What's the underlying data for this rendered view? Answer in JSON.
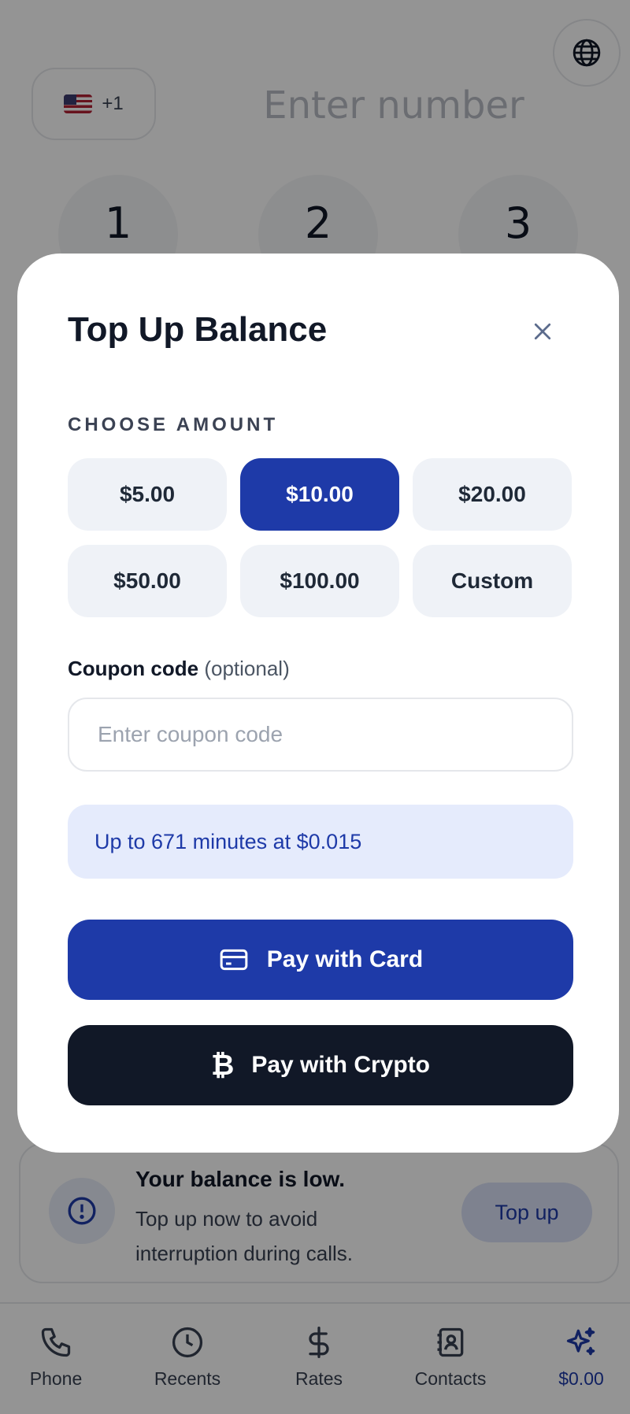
{
  "dialer": {
    "country_code": "+1",
    "number_placeholder": "Enter number",
    "keys": [
      "1",
      "2",
      "3"
    ]
  },
  "balance_alert": {
    "title": "Your balance is low.",
    "message": "Top up now to avoid interruption during calls.",
    "button_label": "Top up"
  },
  "nav": {
    "items": [
      {
        "label": "Phone",
        "icon": "phone-icon"
      },
      {
        "label": "Recents",
        "icon": "clock-icon"
      },
      {
        "label": "Rates",
        "icon": "dollar-icon"
      },
      {
        "label": "Contacts",
        "icon": "contacts-icon"
      },
      {
        "label": "$0.00",
        "icon": "sparkle-icon",
        "active": true
      }
    ]
  },
  "modal": {
    "title": "Top Up Balance",
    "amount_label": "CHOOSE AMOUNT",
    "amounts": [
      "$5.00",
      "$10.00",
      "$20.00",
      "$50.00",
      "$100.00",
      "Custom"
    ],
    "selected_amount": "$10.00",
    "coupon_label": "Coupon code",
    "coupon_optional": "(optional)",
    "coupon_placeholder": "Enter coupon code",
    "info": "Up to 671 minutes at $0.015",
    "pay_card_label": "Pay with Card",
    "pay_crypto_label": "Pay with Crypto"
  },
  "colors": {
    "accent": "#1e3aa8",
    "dark_button": "#111827",
    "info_bg": "#e5ebfc"
  }
}
